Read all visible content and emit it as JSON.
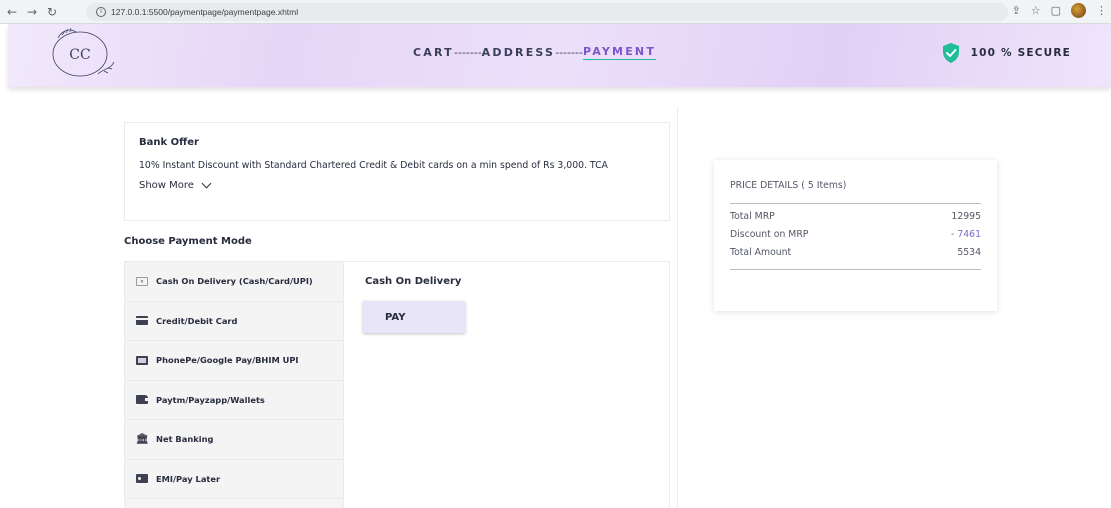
{
  "browser": {
    "url": "127.0.0.1:5500/paymentpage/paymentpage.xhtml"
  },
  "header": {
    "logo_text": "CC",
    "steps": {
      "cart": "CART",
      "sep1": "-------",
      "address": "ADDRESS",
      "sep2": "-------",
      "payment": "PAYMENT"
    },
    "secure_label": "100 % SECURE",
    "colors": {
      "accent": "#7d55c7",
      "secure_green": "#20bd99"
    }
  },
  "bank_offer": {
    "title": "Bank Offer",
    "text": "10% Instant Discount with Standard Chartered Credit & Debit cards on a min spend of Rs 3,000. TCA",
    "show_more": "Show More"
  },
  "choose_payment_label": "Choose Payment Mode",
  "payment_modes": [
    {
      "icon": "cash-icon",
      "label": "Cash On Delivery (Cash/Card/UPI)"
    },
    {
      "icon": "card-icon",
      "label": "Credit/Debit Card"
    },
    {
      "icon": "upi-icon",
      "label": "PhonePe/Google Pay/BHIM UPI"
    },
    {
      "icon": "wallet-icon",
      "label": "Paytm/Payzapp/Wallets"
    },
    {
      "icon": "bank-icon",
      "label": "Net Banking"
    },
    {
      "icon": "emi-icon",
      "label": "EMI/Pay Later"
    }
  ],
  "selected_mode": {
    "title": "Cash On Delivery",
    "button_label": "PAY"
  },
  "price_details": {
    "title": "PRICE DETAILS ( 5 Items)",
    "rows": [
      {
        "label": "Total MRP",
        "value": "12995"
      },
      {
        "label": "Discount on MRP",
        "value": "- 7461"
      },
      {
        "label": "Total Amount",
        "value": "5534"
      }
    ]
  }
}
